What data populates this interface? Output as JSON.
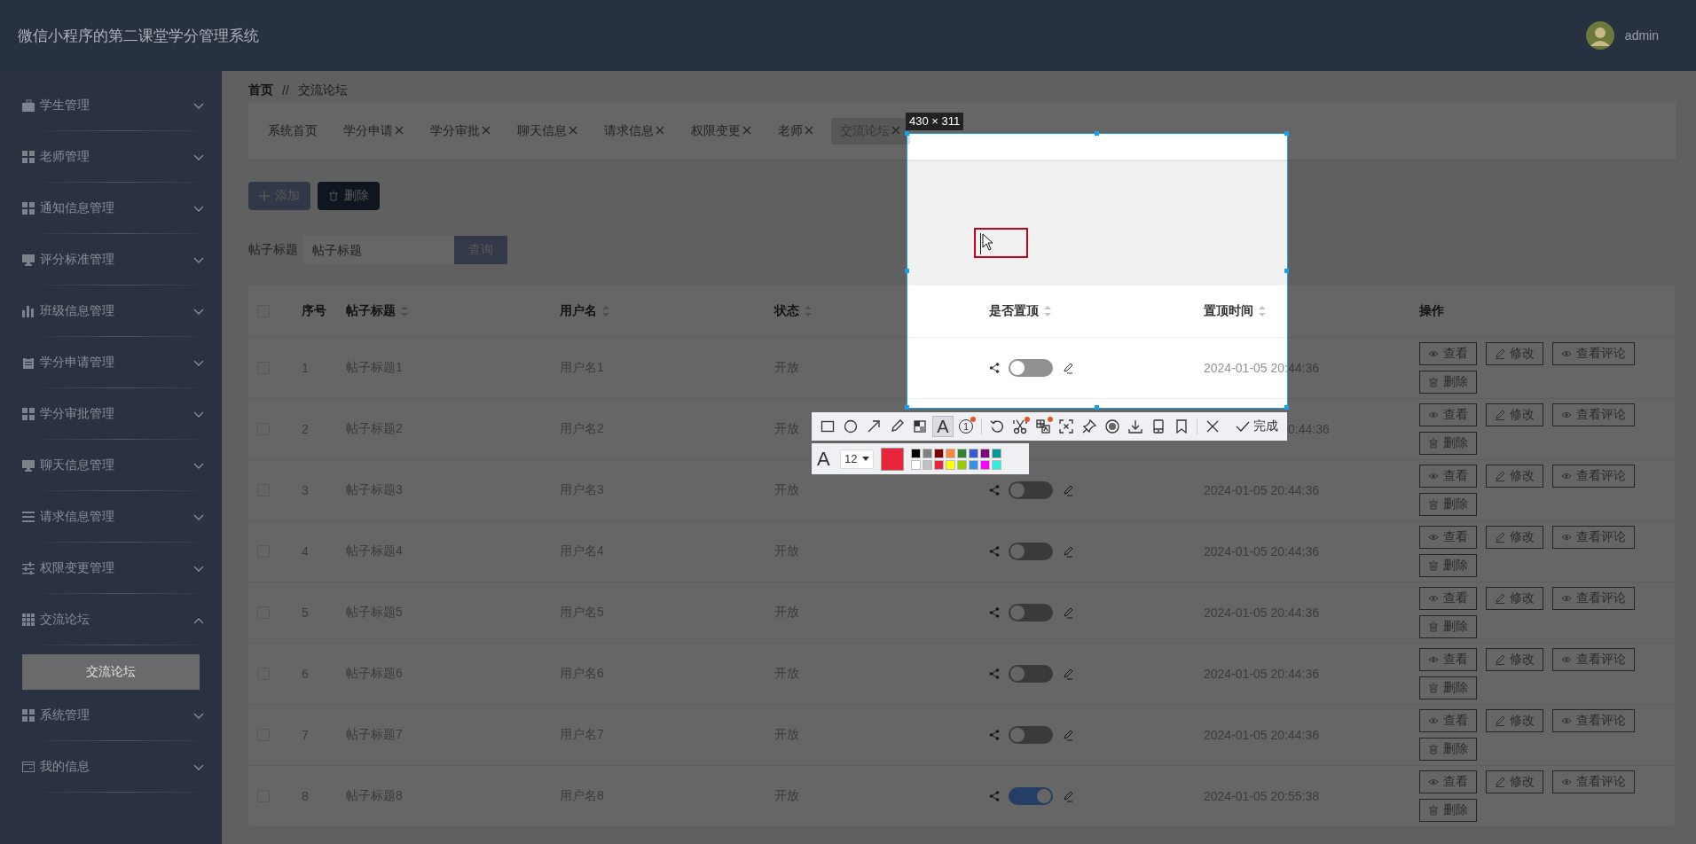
{
  "header": {
    "title": "微信小程序的第二课堂学分管理系统",
    "user": "admin"
  },
  "sidebar": {
    "items": [
      {
        "label": "学生管理",
        "expanded": false
      },
      {
        "label": "老师管理",
        "expanded": false
      },
      {
        "label": "通知信息管理",
        "expanded": false
      },
      {
        "label": "评分标准管理",
        "expanded": false
      },
      {
        "label": "班级信息管理",
        "expanded": false
      },
      {
        "label": "学分申请管理",
        "expanded": false
      },
      {
        "label": "学分审批管理",
        "expanded": false
      },
      {
        "label": "聊天信息管理",
        "expanded": false
      },
      {
        "label": "请求信息管理",
        "expanded": false
      },
      {
        "label": "权限变更管理",
        "expanded": false
      },
      {
        "label": "交流论坛",
        "expanded": true,
        "children": [
          {
            "label": "交流论坛",
            "selected": true
          }
        ]
      },
      {
        "label": "系统管理",
        "expanded": false
      },
      {
        "label": "我的信息",
        "expanded": false
      }
    ]
  },
  "breadcrumb": [
    "首页",
    "//",
    "交流论坛"
  ],
  "tags": [
    {
      "label": "系统首页",
      "closable": false,
      "selected": false
    },
    {
      "label": "学分申请",
      "closable": true,
      "selected": false
    },
    {
      "label": "学分审批",
      "closable": true,
      "selected": false
    },
    {
      "label": "聊天信息",
      "closable": true,
      "selected": false
    },
    {
      "label": "请求信息",
      "closable": true,
      "selected": false
    },
    {
      "label": "权限变更",
      "closable": true,
      "selected": false
    },
    {
      "label": "老师",
      "closable": true,
      "selected": false
    },
    {
      "label": "交流论坛",
      "closable": true,
      "selected": true
    }
  ],
  "actions": [
    "添加",
    "删除"
  ],
  "search": {
    "label": "帖子标题",
    "placeholder": "帖子标题",
    "button": "查询"
  },
  "table": {
    "all_checked": false,
    "columns": [
      {
        "label": "序号",
        "sortable": false
      },
      {
        "label": "帖子标题",
        "sortable": true
      },
      {
        "label": "用户名",
        "sortable": true
      },
      {
        "label": "状态",
        "sortable": true
      },
      {
        "label": "是否置顶",
        "sortable": true
      },
      {
        "label": "置顶时间",
        "sortable": true
      },
      {
        "label": "操作",
        "sortable": false
      }
    ],
    "rows": [
      {
        "checked": false,
        "index": "1",
        "title": "帖子标题1",
        "user": "用户名1",
        "status": "开放",
        "pinned": false,
        "pin_time": "2024-01-05 20:44:36",
        "actions": [
          "查看",
          "修改",
          "查看评论",
          "删除"
        ]
      },
      {
        "checked": false,
        "index": "2",
        "title": "帖子标题2",
        "user": "用户名2",
        "status": "开放",
        "pin_time": "0:44:36",
        "pin_time_partial": true,
        "actions": [
          "查看",
          "修改",
          "查看评论",
          "删除"
        ]
      },
      {
        "checked": false,
        "index": "3",
        "title": "帖子标题3",
        "user": "用户名3",
        "status": "开放",
        "pinned": false,
        "pin_time": "2024-01-05 20:44:36",
        "actions": [
          "查看",
          "修改",
          "查看评论",
          "删除"
        ]
      },
      {
        "checked": false,
        "index": "4",
        "title": "帖子标题4",
        "user": "用户名4",
        "status": "开放",
        "pinned": false,
        "pin_time": "2024-01-05 20:44:36",
        "actions": [
          "查看",
          "修改",
          "查看评论",
          "删除"
        ]
      },
      {
        "checked": false,
        "index": "5",
        "title": "帖子标题5",
        "user": "用户名5",
        "status": "开放",
        "pinned": false,
        "pin_time": "2024-01-05 20:44:36",
        "actions": [
          "查看",
          "修改",
          "查看评论",
          "删除"
        ]
      },
      {
        "checked": false,
        "index": "6",
        "title": "帖子标题6",
        "user": "用户名6",
        "status": "开放",
        "pinned": false,
        "pin_time": "2024-01-05 20:44:36",
        "actions": [
          "查看",
          "修改",
          "查看评论",
          "删除"
        ]
      },
      {
        "checked": false,
        "index": "7",
        "title": "帖子标题7",
        "user": "用户名7",
        "status": "开放",
        "pinned": false,
        "pin_time": "2024-01-05 20:44:36",
        "actions": [
          "查看",
          "修改",
          "查看评论",
          "删除"
        ]
      },
      {
        "checked": false,
        "index": "8",
        "title": "帖子标题8",
        "user": "用户名8",
        "status": "开放",
        "pinned": true,
        "pin_time": "2024-01-05 20:55:38",
        "actions": [
          "查看",
          "修改",
          "查看评论",
          "删除"
        ]
      }
    ]
  },
  "capture_tool": {
    "size_label": "430 × 311",
    "done_label": "完成",
    "text_glyph": "A",
    "font_size": "12",
    "tools": [
      {
        "selected": false,
        "badge": false
      },
      {
        "selected": false,
        "badge": false
      },
      {
        "selected": false,
        "badge": false
      },
      {
        "selected": false,
        "badge": false
      },
      {
        "selected": false,
        "badge": false
      },
      {
        "selected": true,
        "badge": false,
        "glyph": "A"
      },
      {
        "selected": false,
        "badge": true,
        "glyph": "1"
      },
      {
        "selected": false,
        "badge": false
      },
      {
        "selected": false,
        "badge": true
      },
      {
        "selected": false,
        "badge": true
      },
      {
        "selected": false,
        "badge": false
      },
      {
        "selected": false,
        "badge": false
      },
      {
        "selected": false,
        "badge": false
      },
      {
        "selected": false,
        "badge": false
      },
      {
        "selected": false,
        "badge": false
      },
      {
        "selected": false,
        "badge": false
      },
      {
        "selected": false,
        "badge": false
      }
    ],
    "current": {
      "color": "#e8253b"
    },
    "palette": [
      {
        "color": "#000000"
      },
      {
        "color": "#808080"
      },
      {
        "color": "#800000"
      },
      {
        "color": "#f7883a"
      },
      {
        "color": "#308430"
      },
      {
        "color": "#385ad3"
      },
      {
        "color": "#800080"
      },
      {
        "color": "#009999"
      },
      {
        "color": "#ffffff"
      },
      {
        "color": "#c0c0c0"
      },
      {
        "color": "#e8253b"
      },
      {
        "color": "#ffff00"
      },
      {
        "color": "#99cc00"
      },
      {
        "color": "#3894e1"
      },
      {
        "color": "#ff00ff"
      },
      {
        "color": "#30f0dc"
      }
    ]
  }
}
